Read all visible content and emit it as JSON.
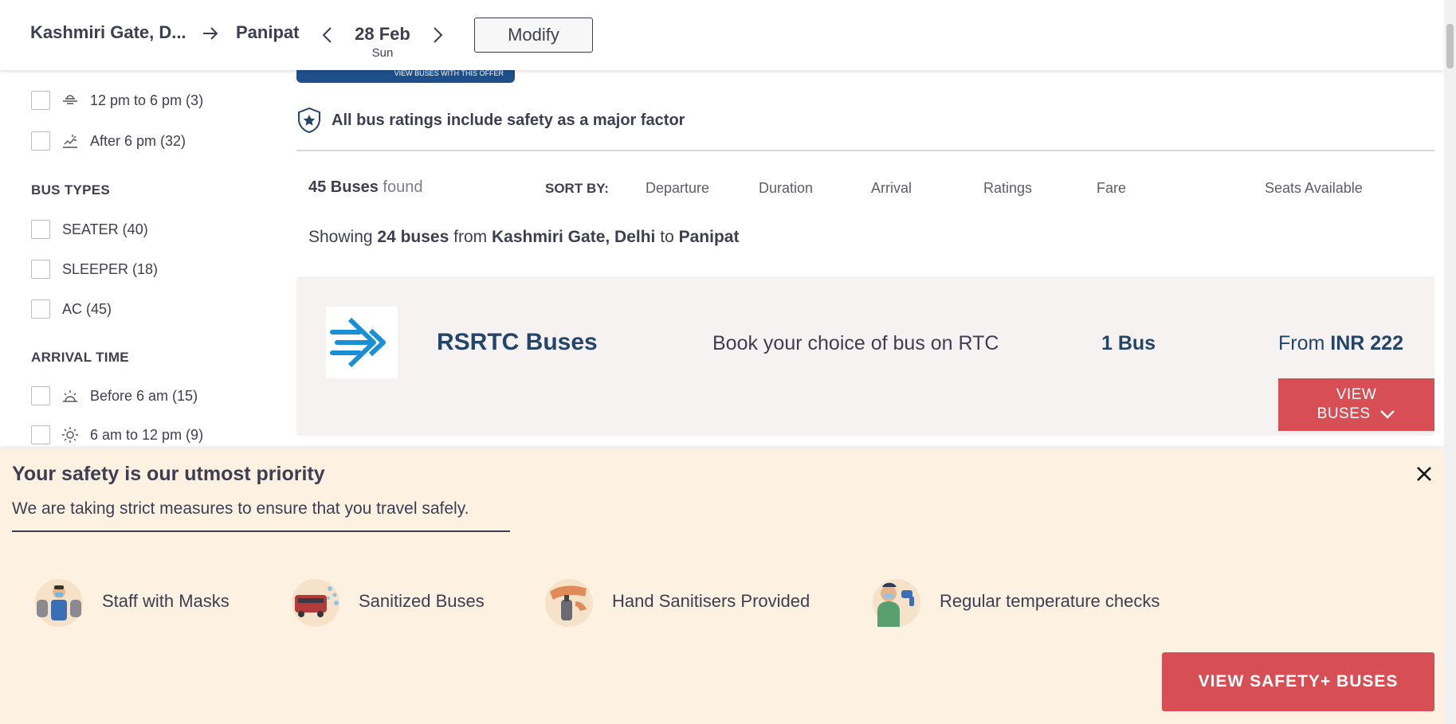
{
  "header": {
    "from": "Kashmiri Gate, D...",
    "to": "Panipat",
    "date": "28 Feb",
    "weekday": "Sun",
    "modify_label": "Modify"
  },
  "filters": {
    "departure_items": [
      {
        "label": "12 pm to 6 pm (3)",
        "icon": "sun-horizon-icon"
      },
      {
        "label": "After 6 pm (32)",
        "icon": "sunset-icon"
      }
    ],
    "bus_types_title": "BUS TYPES",
    "bus_types": [
      {
        "label": "SEATER (40)"
      },
      {
        "label": "SLEEPER (18)"
      },
      {
        "label": "AC (45)"
      }
    ],
    "arrival_title": "ARRIVAL TIME",
    "arrival_items": [
      {
        "label": "Before 6 am (15)",
        "icon": "sunrise-icon"
      },
      {
        "label": "6 am to 12 pm (9)",
        "icon": "sun-icon"
      }
    ]
  },
  "offer": {
    "label": "VIEW BUSES WITH THIS OFFER"
  },
  "safety_note": "All bus ratings include safety as a major factor",
  "results": {
    "count": "45 Buses",
    "found_word": "found",
    "sort_by": "SORT BY:",
    "sort_options": [
      "Departure",
      "Duration",
      "Arrival",
      "Ratings",
      "Fare",
      "Seats Available"
    ],
    "showing_prefix": "Showing",
    "showing_count": "24 buses",
    "showing_from_word": "from",
    "showing_from": "Kashmiri Gate, Delhi",
    "showing_to_word": "to",
    "showing_to": "Panipat"
  },
  "operator_card": {
    "name": "RSRTC Buses",
    "description": "Book your choice of bus on RTC",
    "bus_count": "1 Bus",
    "from_word": "From",
    "price": "INR 222",
    "view_line1": "VIEW",
    "view_line2": "BUSES"
  },
  "safety_panel": {
    "title": "Your safety is our utmost priority",
    "subtitle": "We are taking strict measures to ensure that you travel safely.",
    "features": [
      {
        "label": "Staff with Masks",
        "icon": "staff-mask-icon"
      },
      {
        "label": "Sanitized Buses",
        "icon": "sanitized-bus-icon"
      },
      {
        "label": "Hand Sanitisers Provided",
        "icon": "hand-sanitiser-icon"
      },
      {
        "label": "Regular temperature checks",
        "icon": "temperature-check-icon"
      }
    ],
    "cta": "VIEW SAFETY+ BUSES"
  },
  "colors": {
    "accent_red": "#d84e55",
    "navy": "#23456a",
    "panel_bg": "#fdf1e2",
    "card_bg": "#f6f2f1"
  }
}
